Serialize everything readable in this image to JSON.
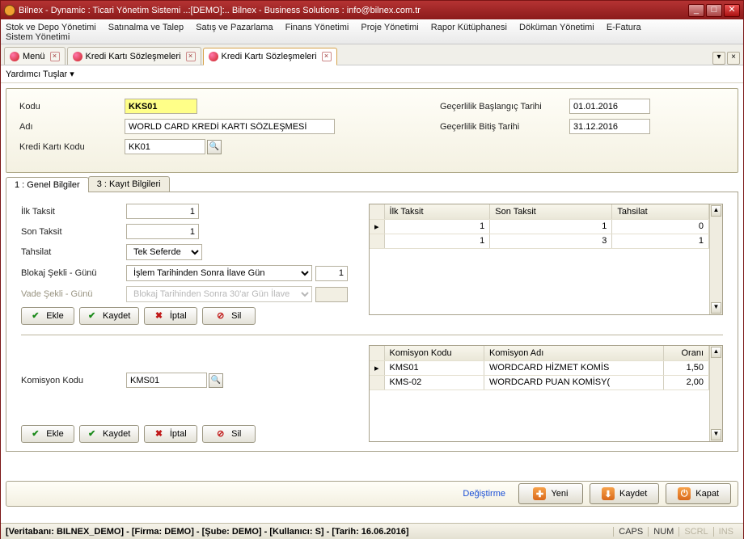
{
  "window": {
    "title": "Bilnex - Dynamic : Ticari Yönetim Sistemi       ..:[DEMO]:..     Bilnex - Business Solutions : info@bilnex.com.tr"
  },
  "menu": {
    "items": [
      "Stok ve Depo Yönetimi",
      "Satınalma ve Talep",
      "Satış ve Pazarlama",
      "Finans Yönetimi",
      "Proje Yönetimi",
      "Rapor Kütüphanesi",
      "Döküman Yönetimi",
      "E-Fatura",
      "Sistem Yönetimi"
    ]
  },
  "tabs": {
    "items": [
      {
        "label": "Menü",
        "active": false
      },
      {
        "label": "Kredi Kartı Sözleşmeleri",
        "active": false
      },
      {
        "label": "Kredi Kartı Sözleşmeleri",
        "active": true
      }
    ]
  },
  "aux_label": "Yardımcı Tuşlar  ▾",
  "header": {
    "kodu_label": "Kodu",
    "kodu": "KKS01",
    "adi_label": "Adı",
    "adi": "WORLD CARD KREDİ KARTI SÖZLEŞMESİ",
    "kk_label": "Kredi Kartı Kodu",
    "kk": "KK01",
    "start_label": "Geçerlilik Başlangıç Tarihi",
    "start": "01.01.2016",
    "end_label": "Geçerlilik Bitiş Tarihi",
    "end": "31.12.2016"
  },
  "inner_tabs": {
    "t1": "1 : Genel Bilgiler",
    "t2": "3 : Kayıt Bilgileri"
  },
  "taksit": {
    "ilk_label": "İlk Taksit",
    "ilk": "1",
    "son_label": "Son Taksit",
    "son": "1",
    "tahsilat_label": "Tahsilat",
    "tahsilat_sel": "Tek Seferde",
    "blokaj_label": "Blokaj Şekli - Günü",
    "blokaj_sel": "İşlem Tarihinden Sonra İlave Gün",
    "blokaj_gun": "1",
    "vade_label": "Vade Şekli - Günü",
    "vade_sel": "Blokaj Tarihinden Sonra 30'ar Gün İlave",
    "vade_gun": ""
  },
  "buttons": {
    "ekle": "Ekle",
    "kaydet": "Kaydet",
    "iptal": "İptal",
    "sil": "Sil"
  },
  "taksit_grid": {
    "cols": [
      "İlk Taksit",
      "Son Taksit",
      "Tahsilat"
    ],
    "rows": [
      {
        "ilk": "1",
        "son": "1",
        "tah": "0",
        "ptr": "▸"
      },
      {
        "ilk": "1",
        "son": "3",
        "tah": "1",
        "ptr": ""
      }
    ]
  },
  "komisyon": {
    "label": "Komisyon Kodu",
    "value": "KMS01"
  },
  "komisyon_grid": {
    "cols": [
      "Komisyon Kodu",
      "Komisyon Adı",
      "Oranı"
    ],
    "rows": [
      {
        "kod": "KMS01",
        "ad": "WORDCARD HİZMET KOMİS",
        "oran": "1,50",
        "ptr": "▸"
      },
      {
        "kod": "KMS-02",
        "ad": "WORDCARD PUAN KOMİSY(",
        "oran": "2,00",
        "ptr": ""
      }
    ]
  },
  "footer": {
    "link": "Değiştirme",
    "yeni": "Yeni",
    "kaydet": "Kaydet",
    "kapat": "Kapat"
  },
  "status": {
    "text": "[Veritabanı: BILNEX_DEMO] - [Firma: DEMO] - [Şube: DEMO] - [Kullanıcı: S] - [Tarih: 16.06.2016]",
    "caps": "CAPS",
    "num": "NUM",
    "scrl": "SCRL",
    "ins": "INS"
  }
}
